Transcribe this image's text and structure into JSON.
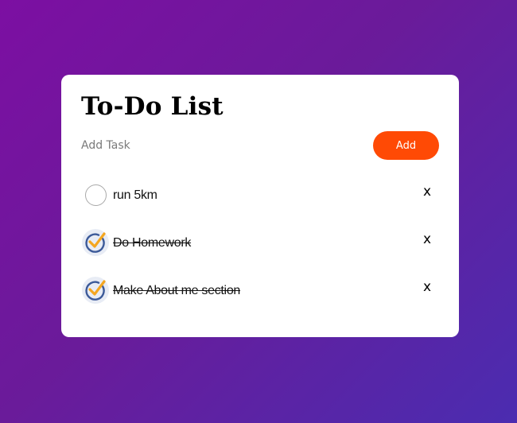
{
  "app": {
    "title": "To-Do List"
  },
  "add_task": {
    "placeholder": "Add Task",
    "button_label": "Add"
  },
  "colors": {
    "accent": "#ff4a05",
    "check_blue": "#3c5a99",
    "check_orange": "#f4a620"
  },
  "tasks": [
    {
      "text": "run 5km",
      "done": false,
      "remove_label": "x"
    },
    {
      "text": "Do Homework",
      "done": true,
      "remove_label": "x"
    },
    {
      "text": "Make About me section",
      "done": true,
      "remove_label": "x"
    }
  ]
}
